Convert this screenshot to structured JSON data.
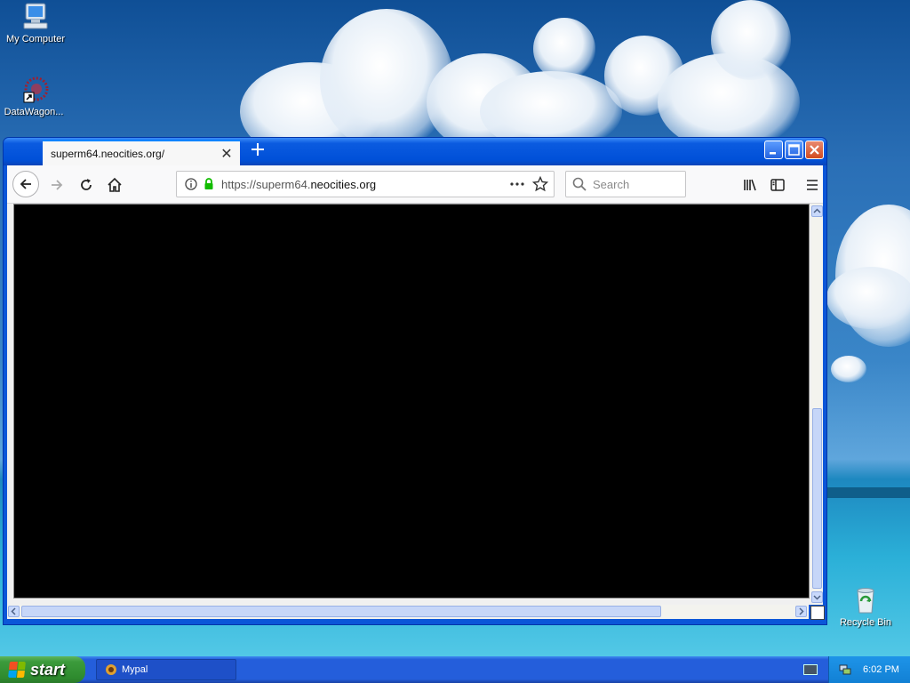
{
  "desktop": {
    "icons": [
      {
        "label": "My Computer",
        "icon": "my-computer-icon"
      },
      {
        "label": "DataWagon...",
        "icon": "datawagon-shortcut-icon"
      },
      {
        "label": "Recycle Bin",
        "icon": "recycle-bin-icon"
      }
    ]
  },
  "browser": {
    "tab_title": "superm64.neocities.org/",
    "url_prefix": "https://superm64.",
    "url_domain": "neocities.org",
    "search_placeholder": "Search",
    "icons": {
      "back": "back-arrow-icon",
      "forward": "forward-arrow-icon",
      "reload": "reload-icon",
      "home": "home-icon",
      "info": "info-icon",
      "lock": "lock-icon",
      "page_actions": "ellipsis-icon",
      "bookmark": "star-icon",
      "library": "library-icon",
      "sidebar": "sidebar-icon",
      "menu": "hamburger-menu-icon"
    },
    "lock_color": "#12bc00",
    "tab_accent": "#0a84ff"
  },
  "taskbar": {
    "start_label": "start",
    "tasks": [
      {
        "label": "Mypal"
      }
    ],
    "clock": "6:02 PM"
  }
}
